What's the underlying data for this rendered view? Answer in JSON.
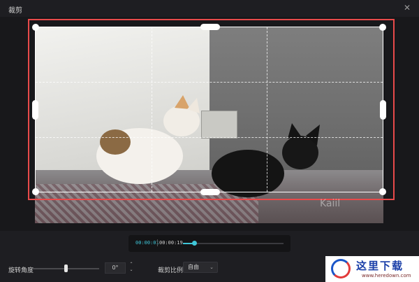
{
  "window": {
    "title": "裁剪",
    "close_symbol": "✕"
  },
  "preview": {
    "watermark_text": "Kaiil"
  },
  "player": {
    "current_time": "00:00:01",
    "total_time": "00:00:19",
    "progress": 0.11
  },
  "controls": {
    "rotation_label": "旋转角度",
    "rotation_value": "0°",
    "rotation_level": 0.5,
    "ratio_label": "裁剪比例",
    "ratio_value": "自由",
    "stepper_up": "⌃",
    "stepper_down": "⌄",
    "chevron": "⌄"
  },
  "site_watermark": {
    "text": "这里下载",
    "url": "www.heredown.com"
  },
  "colors": {
    "accent": "#3fc6d8",
    "highlight": "#e84a4a",
    "background": "#1e1e22"
  }
}
